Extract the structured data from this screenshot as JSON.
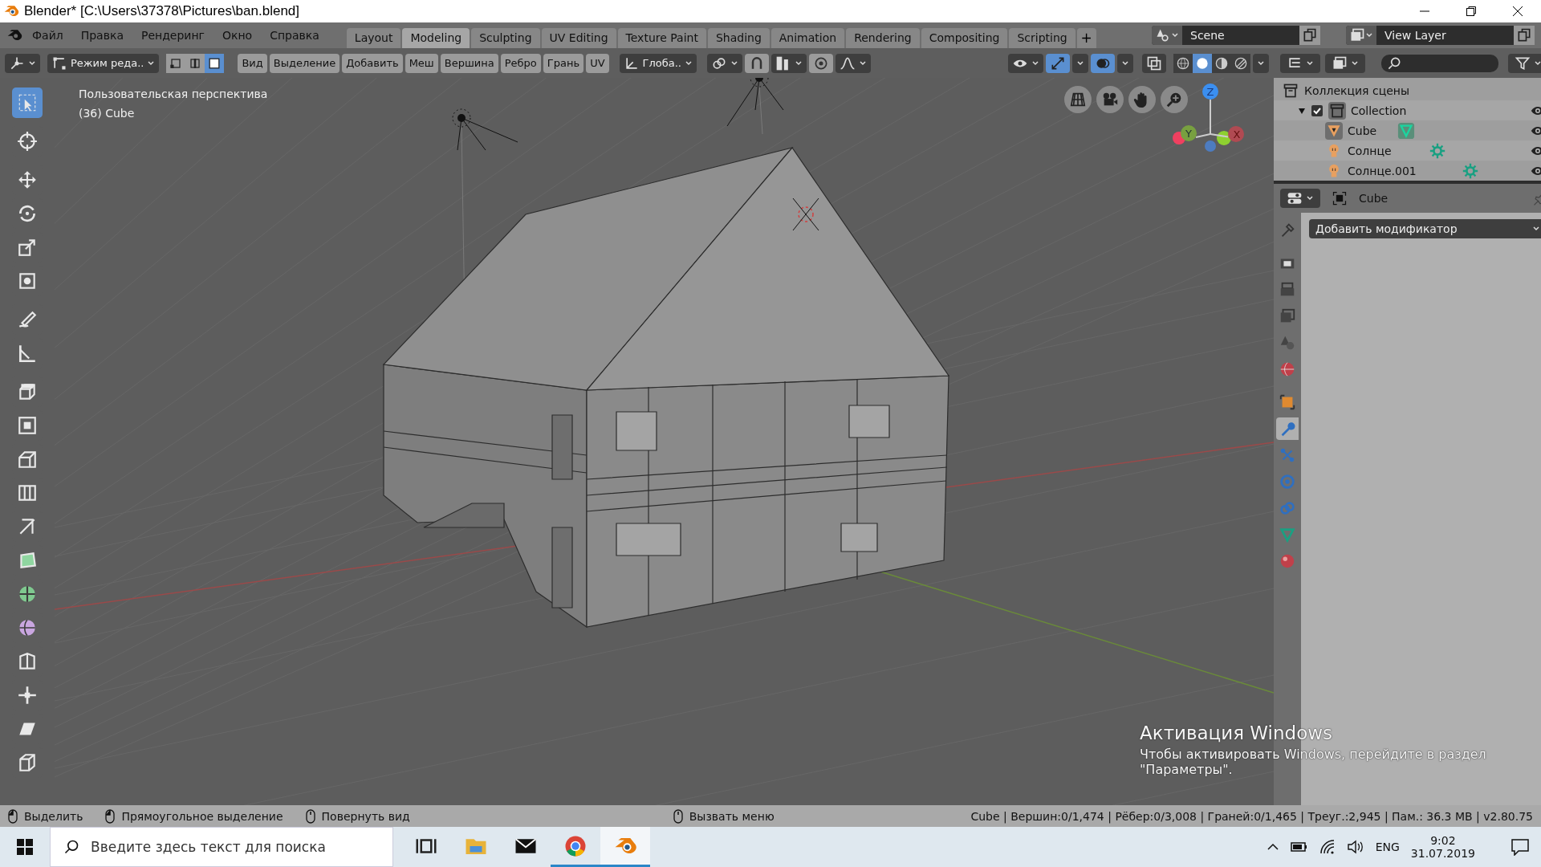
{
  "window": {
    "title": "Blender* [C:\\Users\\37378\\Pictures\\ban.blend]"
  },
  "menu": [
    "Файл",
    "Правка",
    "Рендеринг",
    "Окно",
    "Справка"
  ],
  "workspaces": [
    {
      "label": "Layout",
      "selected": false
    },
    {
      "label": "Modeling",
      "selected": true
    },
    {
      "label": "Sculpting",
      "selected": false
    },
    {
      "label": "UV Editing",
      "selected": false
    },
    {
      "label": "Texture Paint",
      "selected": false
    },
    {
      "label": "Shading",
      "selected": false
    },
    {
      "label": "Animation",
      "selected": false
    },
    {
      "label": "Rendering",
      "selected": false
    },
    {
      "label": "Compositing",
      "selected": false
    },
    {
      "label": "Scripting",
      "selected": false
    }
  ],
  "add_workspace": "+",
  "scene": {
    "name": "Scene"
  },
  "view_layer": {
    "name": "View Layer"
  },
  "viewport_header": {
    "mode": "Режим реда..",
    "select_modes": [
      {
        "kind": "vertex",
        "selected": false
      },
      {
        "kind": "edge",
        "selected": false
      },
      {
        "kind": "face",
        "selected": true
      }
    ],
    "menus": [
      "Вид",
      "Выделение",
      "Добавить",
      "Меш",
      "Вершина",
      "Ребро",
      "Грань",
      "UV"
    ],
    "orientation": "Глоба..",
    "gizmos": {
      "on": true
    },
    "overlays": {
      "on": true
    },
    "xray": {
      "on": false
    },
    "shading": [
      {
        "kind": "wireframe",
        "selected": false
      },
      {
        "kind": "solid",
        "selected": true
      },
      {
        "kind": "material",
        "selected": false
      },
      {
        "kind": "rendered",
        "selected": false
      }
    ]
  },
  "viewport": {
    "view_name": "Пользовательская перспектива",
    "object_info": "(36) Cube",
    "gizmo": {
      "z": "Z",
      "y": "Y",
      "x": "X"
    }
  },
  "tools": [
    {
      "kind": "select",
      "selected": true
    },
    {
      "kind": "cursor",
      "selected": false
    },
    {
      "kind": "move",
      "selected": false
    },
    {
      "kind": "rotate",
      "selected": false
    },
    {
      "kind": "scale",
      "selected": false
    },
    {
      "kind": "transform",
      "selected": false
    },
    {
      "kind": "annotate",
      "selected": false
    },
    {
      "kind": "measure",
      "selected": false
    },
    {
      "kind": "extrude",
      "selected": false
    },
    {
      "kind": "inset",
      "selected": false
    },
    {
      "kind": "bevel",
      "selected": false
    },
    {
      "kind": "loopcut",
      "selected": false
    },
    {
      "kind": "knife",
      "selected": false
    },
    {
      "kind": "polybuild",
      "selected": false
    },
    {
      "kind": "spin",
      "selected": false
    },
    {
      "kind": "smooth",
      "selected": false
    },
    {
      "kind": "slide",
      "selected": false
    },
    {
      "kind": "shrink",
      "selected": false
    },
    {
      "kind": "shear",
      "selected": false
    },
    {
      "kind": "rip",
      "selected": false
    }
  ],
  "outliner": {
    "root": "Коллекция сцены",
    "items": [
      {
        "label": "Collection",
        "kind": "collection",
        "checked": true,
        "expanded": true,
        "visible": true,
        "children": [
          {
            "label": "Cube",
            "kind": "mesh",
            "selected": true,
            "visible": true
          },
          {
            "label": "Солнце",
            "kind": "light",
            "selected": false,
            "visible": true
          },
          {
            "label": "Солнце.001",
            "kind": "light",
            "selected": false,
            "visible": true
          }
        ]
      }
    ]
  },
  "properties": {
    "object": "Cube",
    "add_modifier": "Добавить модификатор",
    "tabs": [
      {
        "kind": "tool",
        "selected": false
      },
      {
        "kind": "render",
        "selected": false
      },
      {
        "kind": "output",
        "selected": false
      },
      {
        "kind": "viewlayer",
        "selected": false
      },
      {
        "kind": "scene",
        "selected": false
      },
      {
        "kind": "world",
        "selected": false
      },
      {
        "kind": "object",
        "selected": false
      },
      {
        "kind": "modifier",
        "selected": true
      },
      {
        "kind": "particles",
        "selected": false
      },
      {
        "kind": "physics",
        "selected": false
      },
      {
        "kind": "constraints",
        "selected": false
      },
      {
        "kind": "data",
        "selected": false
      },
      {
        "kind": "material",
        "selected": false
      }
    ]
  },
  "activation": {
    "title": "Активация Windows",
    "text": "Чтобы активировать Windows, перейдите в раздел \"Параметры\"."
  },
  "status_bar": {
    "hints": [
      "Выделить",
      "Прямоугольное выделение",
      "Повернуть вид",
      "Вызвать меню"
    ],
    "stats": "Cube | Вершин:0/1,474 | Рёбер:0/3,008 | Граней:0/1,465 | Треуг.:2,945 | Пам.: 36.3 MB | v2.80.75"
  },
  "taskbar": {
    "search_placeholder": "Введите здесь текст для поиска",
    "apps": [
      {
        "kind": "taskview",
        "running": false,
        "selected": false
      },
      {
        "kind": "folder",
        "running": false,
        "selected": false
      },
      {
        "kind": "mail",
        "running": false,
        "selected": false
      },
      {
        "kind": "chrome",
        "running": true,
        "selected": false
      },
      {
        "kind": "blender",
        "running": true,
        "selected": true
      }
    ],
    "language": "ENG",
    "time": "9:02",
    "date": "31.07.2019"
  }
}
